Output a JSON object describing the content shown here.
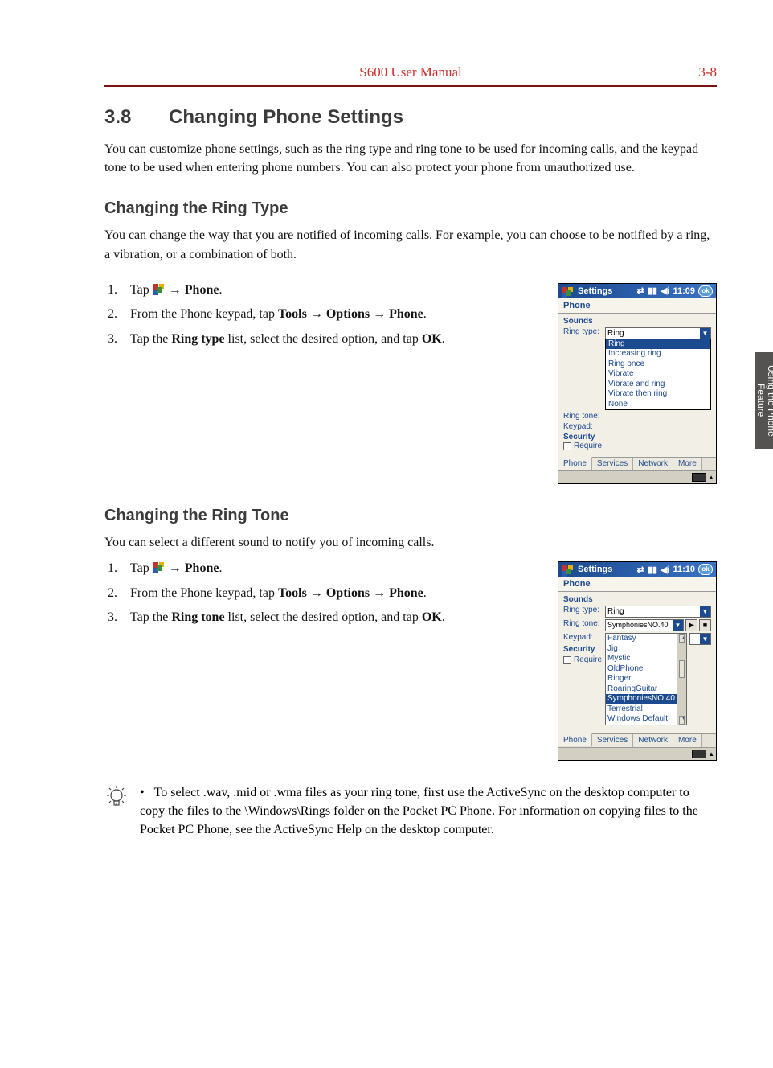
{
  "header": {
    "title": "S600 User Manual",
    "page": "3-8"
  },
  "section": {
    "number": "3.8",
    "title": "Changing Phone Settings",
    "intro": "You can customize phone settings, such as the ring type and ring tone to be used for incoming calls, and the keypad tone to be used when entering phone numbers. You can also protect your phone from unauthorized use."
  },
  "ring_type": {
    "heading": "Changing the Ring Type",
    "intro": "You can change the way that you are notified of incoming calls. For example, you can choose to be notified by a ring, a vibration, or a combination of both.",
    "step1_prefix": "Tap ",
    "step1_arrow": " → ",
    "step1_target": "Phone",
    "step1_suffix": ".",
    "step2_prefix": "From the Phone keypad, tap ",
    "step2_chain": "Tools → Options → Phone",
    "step2_suffix": ".",
    "step3_prefix": "Tap the ",
    "step3_bold": "Ring type",
    "step3_mid": " list, select the desired option, and tap ",
    "step3_ok": "OK",
    "step3_suffix": "."
  },
  "ring_tone": {
    "heading": "Changing the Ring Tone",
    "intro": "You can select a different sound to notify you of incoming calls.",
    "step1_prefix": "Tap ",
    "step1_arrow": " → ",
    "step1_target": "Phone",
    "step1_suffix": ".",
    "step2_prefix": "From the Phone keypad, tap ",
    "step2_chain": "Tools → Options → Phone",
    "step2_suffix": ".",
    "step3_prefix": "Tap the ",
    "step3_bold": "Ring tone",
    "step3_mid": " list, select the desired option, and tap ",
    "step3_ok": "OK",
    "step3_suffix": "."
  },
  "screenshot1": {
    "title": "Settings",
    "time": "11:09",
    "ok": "ok",
    "phone_label": "Phone",
    "sounds": "Sounds",
    "label_ringtype": "Ring type:",
    "value_ringtype": "Ring",
    "label_ringtone": "Ring tone:",
    "label_keypad": "Keypad:",
    "security": "Security",
    "require": "Require",
    "dropdown": [
      "Ring",
      "Increasing ring",
      "Ring once",
      "Vibrate",
      "Vibrate and ring",
      "Vibrate then ring",
      "None"
    ],
    "tabs": [
      "Phone",
      "Services",
      "Network",
      "More"
    ]
  },
  "screenshot2": {
    "title": "Settings",
    "time": "11:10",
    "ok": "ok",
    "phone_label": "Phone",
    "sounds": "Sounds",
    "label_ringtype": "Ring type:",
    "value_ringtype": "Ring",
    "label_ringtone": "Ring tone:",
    "value_ringtone": "SymphoniesNO.40",
    "label_keypad": "Keypad:",
    "security": "Security",
    "require": "Require",
    "tonelist": [
      "Fantasy",
      "Jig",
      "Mystic",
      "OldPhone",
      "Ringer",
      "RoaringGuitar",
      "SymphoniesNO.40",
      "Terrestrial",
      "Windows Default"
    ],
    "tabs": [
      "Phone",
      "Services",
      "Network",
      "More"
    ]
  },
  "sidetab": "Using the Phone Feature",
  "tip": {
    "text": "To select .wav, .mid or .wma files as your ring tone, first use the ActiveSync on the desktop computer to copy the files to the \\Windows\\Rings folder on the Pocket PC Phone. For information on copying files to the Pocket PC Phone, see the ActiveSync Help on the desktop computer."
  }
}
